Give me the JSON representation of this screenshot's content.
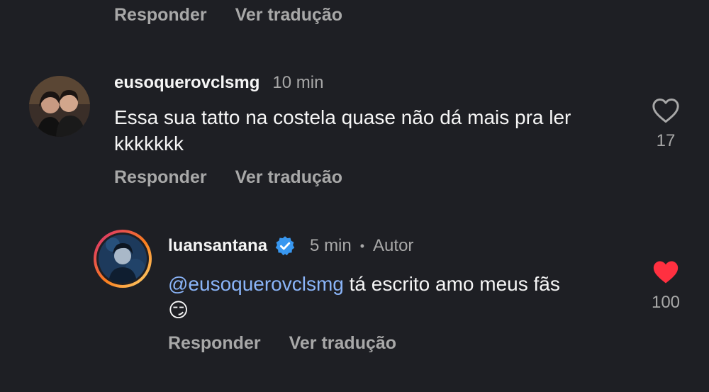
{
  "actions": {
    "reply_label": "Responder",
    "translate_label": "Ver tradução"
  },
  "comments": [
    {
      "username": "eusoquerovclsmg",
      "time": "10 min",
      "text": "Essa sua tatto na costela quase não dá mais pra ler kkkkkkk",
      "likes": "17",
      "liked": false
    }
  ],
  "reply": {
    "username": "luansantana",
    "verified": true,
    "time": "5 min",
    "separator": "•",
    "author_label": "Autor",
    "mention": "@eusoquerovclsmg",
    "text": " tá escrito amo meus fãs",
    "emoji": "😏",
    "likes": "100",
    "liked": true
  },
  "colors": {
    "background": "#1e1f24",
    "heart_active": "#ff3040",
    "verified": "#3897f0",
    "mention": "#8ab4f8"
  }
}
